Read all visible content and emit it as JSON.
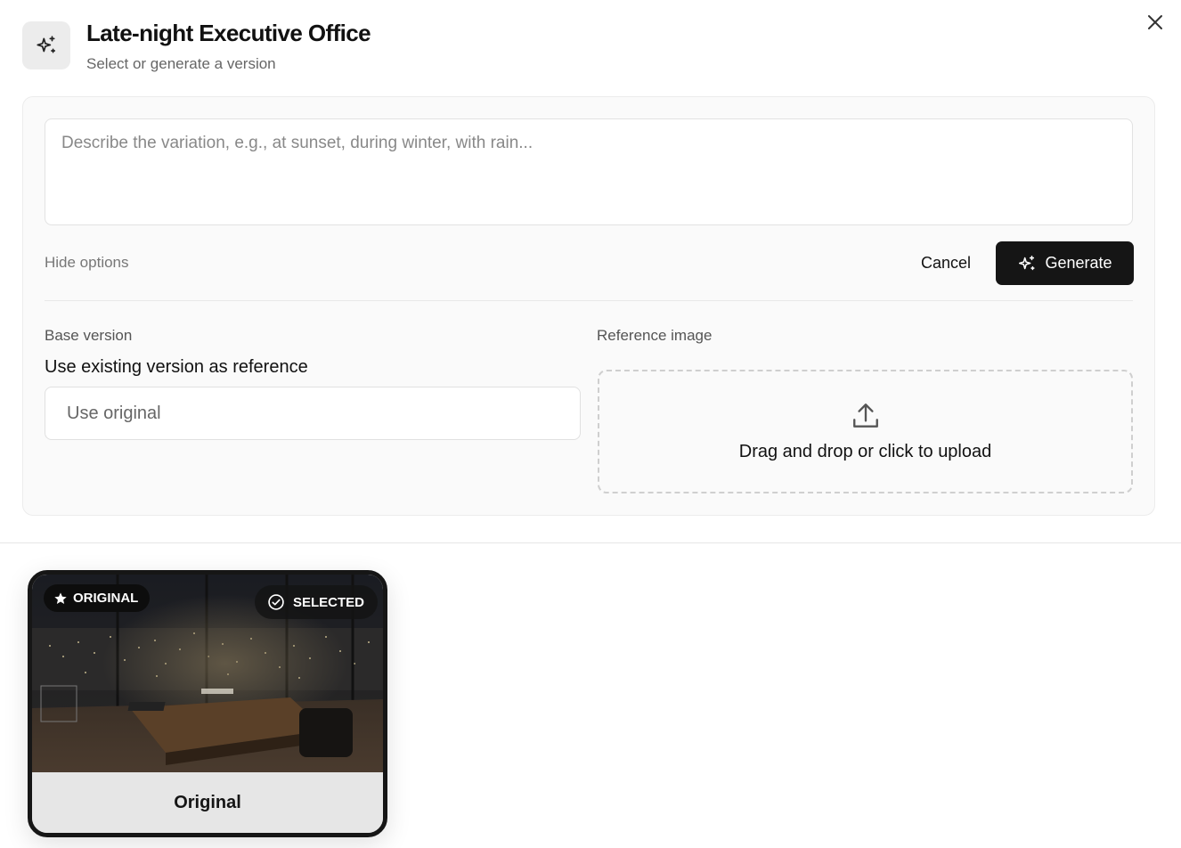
{
  "header": {
    "title": "Late-night Executive Office",
    "subtitle": "Select or generate a version",
    "icon": "sparkles-icon",
    "close_icon": "close-icon"
  },
  "prompt": {
    "placeholder": "Describe the variation, e.g., at sunset, during winter, with rain...",
    "value": ""
  },
  "actions": {
    "hide_options_label": "Hide options",
    "cancel_label": "Cancel",
    "generate_label": "Generate",
    "generate_icon": "sparkles-icon"
  },
  "base_version": {
    "label": "Base version",
    "heading": "Use existing version as reference",
    "selected_value": "Use original"
  },
  "reference_image": {
    "label": "Reference image",
    "upload_text": "Drag and drop or click to upload",
    "upload_icon": "upload-icon"
  },
  "versions": [
    {
      "name": "Original",
      "badge": "ORIGINAL",
      "badge_icon": "star-icon",
      "status": "SELECTED",
      "status_icon": "check-circle-icon"
    }
  ],
  "colors": {
    "primary_button": "#151515",
    "panel_bg": "#fafafa",
    "selected_border": "#161616"
  }
}
